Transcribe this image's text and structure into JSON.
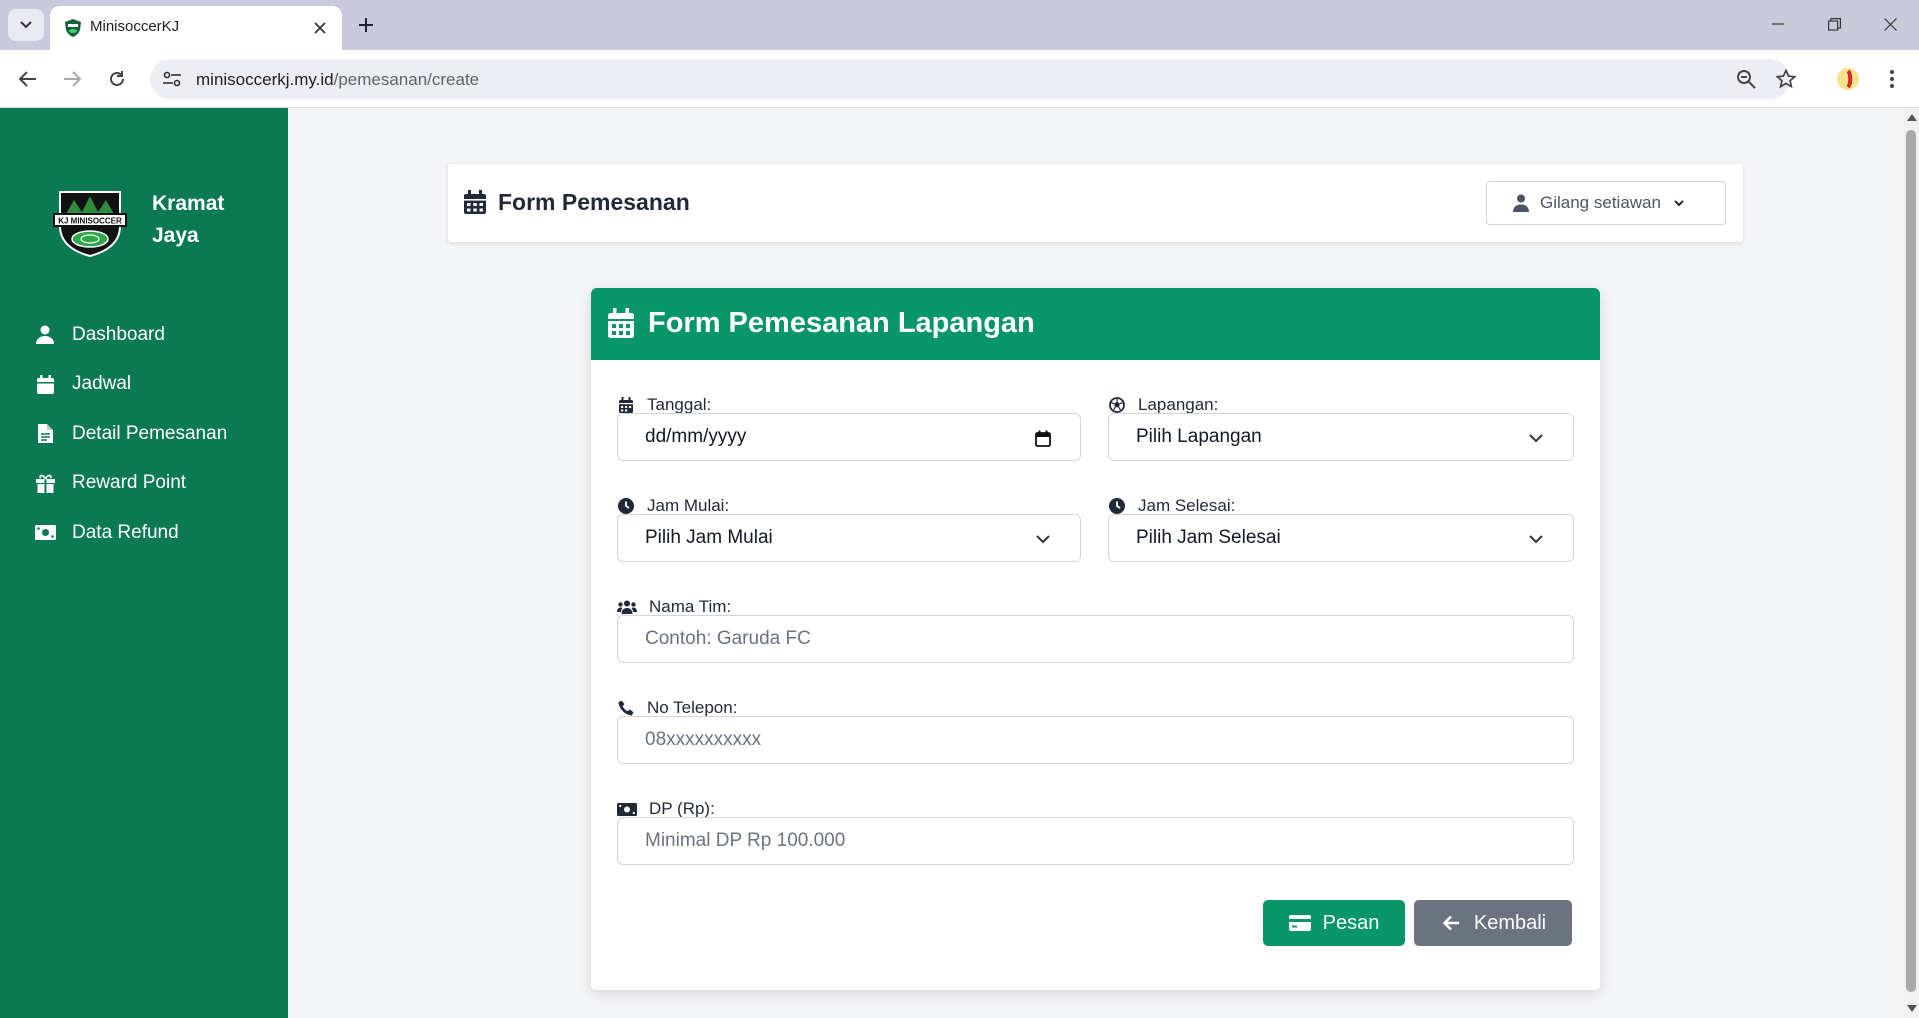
{
  "browser": {
    "tab_title": "MinisoccerKJ",
    "url_domain": "minisoccerkj.my.id",
    "url_path": "/pemesanan/create"
  },
  "sidebar": {
    "brand_line1": "Kramat",
    "brand_line2": "Jaya",
    "logo_text": "KJ MINISOCCER",
    "items": [
      {
        "label": "Dashboard",
        "icon": "user-icon"
      },
      {
        "label": "Jadwal",
        "icon": "calendar-icon"
      },
      {
        "label": "Detail Pemesanan",
        "icon": "document-icon"
      },
      {
        "label": "Reward Point",
        "icon": "gift-icon"
      },
      {
        "label": "Data Refund",
        "icon": "money-icon"
      }
    ]
  },
  "header": {
    "title": "Form Pemesanan",
    "user_name": "Gilang setiawan"
  },
  "form": {
    "title": "Form Pemesanan Lapangan",
    "tanggal_label": "Tanggal:",
    "tanggal_value": "dd/mm/yyyy",
    "lapangan_label": "Lapangan:",
    "lapangan_value": "Pilih Lapangan",
    "jam_mulai_label": "Jam Mulai:",
    "jam_mulai_value": "Pilih Jam Mulai",
    "jam_selesai_label": "Jam Selesai:",
    "jam_selesai_value": "Pilih Jam Selesai",
    "nama_tim_label": "Nama Tim:",
    "nama_tim_placeholder": "Contoh: Garuda FC",
    "telepon_label": "No Telepon:",
    "telepon_placeholder": "08xxxxxxxxxx",
    "dp_label": "DP (Rp):",
    "dp_placeholder": "Minimal DP Rp 100.000",
    "submit_label": "Pesan",
    "back_label": "Kembali"
  },
  "colors": {
    "sidebar": "#0b7a52",
    "primary": "#079669",
    "secondary": "#6b7280"
  }
}
